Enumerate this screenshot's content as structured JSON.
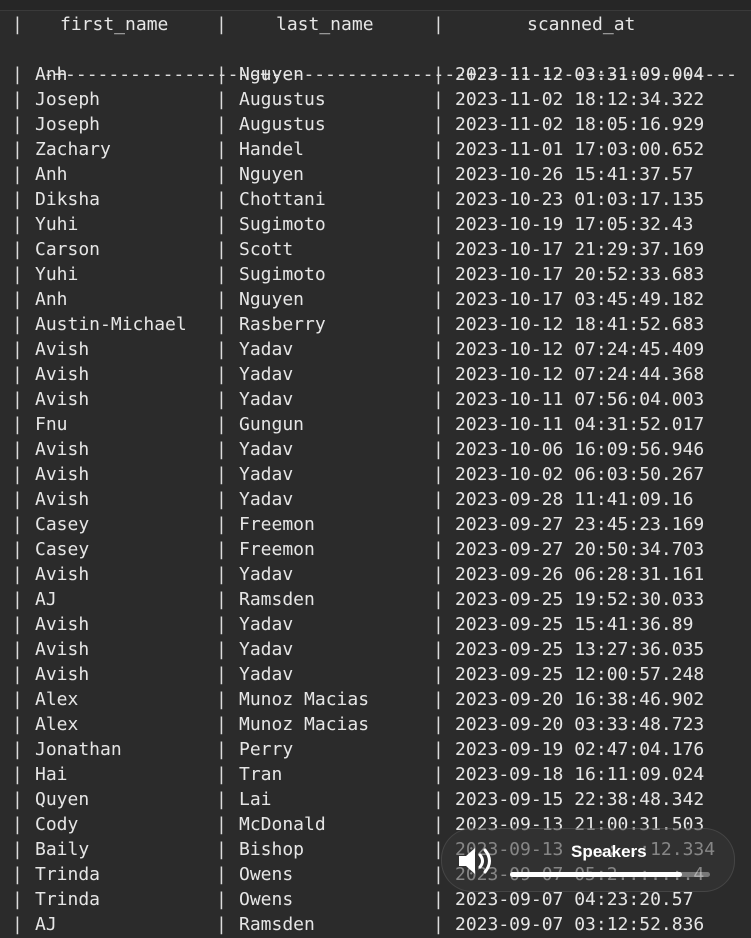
{
  "table": {
    "columns": [
      "first_name",
      "last_name",
      "scanned_at"
    ],
    "separator": "-+------------------+------------------+------------------------",
    "rows": [
      [
        "Anh",
        "Nguyen",
        "2023-11-12 03:31:09.004"
      ],
      [
        "Joseph",
        "Augustus",
        "2023-11-02 18:12:34.322"
      ],
      [
        "Joseph",
        "Augustus",
        "2023-11-02 18:05:16.929"
      ],
      [
        "Zachary",
        "Handel",
        "2023-11-01 17:03:00.652"
      ],
      [
        "Anh",
        "Nguyen",
        "2023-10-26 15:41:37.57"
      ],
      [
        "Diksha",
        "Chottani",
        "2023-10-23 01:03:17.135"
      ],
      [
        "Yuhi",
        "Sugimoto",
        "2023-10-19 17:05:32.43"
      ],
      [
        "Carson",
        "Scott",
        "2023-10-17 21:29:37.169"
      ],
      [
        "Yuhi",
        "Sugimoto",
        "2023-10-17 20:52:33.683"
      ],
      [
        "Anh",
        "Nguyen",
        "2023-10-17 03:45:49.182"
      ],
      [
        "Austin-Michael",
        "Rasberry",
        "2023-10-12 18:41:52.683"
      ],
      [
        "Avish",
        "Yadav",
        "2023-10-12 07:24:45.409"
      ],
      [
        "Avish",
        "Yadav",
        "2023-10-12 07:24:44.368"
      ],
      [
        "Avish",
        "Yadav",
        "2023-10-11 07:56:04.003"
      ],
      [
        "Fnu",
        "Gungun",
        "2023-10-11 04:31:52.017"
      ],
      [
        "Avish",
        "Yadav",
        "2023-10-06 16:09:56.946"
      ],
      [
        "Avish",
        "Yadav",
        "2023-10-02 06:03:50.267"
      ],
      [
        "Avish",
        "Yadav",
        "2023-09-28 11:41:09.16"
      ],
      [
        "Casey",
        "Freemon",
        "2023-09-27 23:45:23.169"
      ],
      [
        "Casey",
        "Freemon",
        "2023-09-27 20:50:34.703"
      ],
      [
        "Avish",
        "Yadav",
        "2023-09-26 06:28:31.161"
      ],
      [
        "AJ",
        "Ramsden",
        "2023-09-25 19:52:30.033"
      ],
      [
        "Avish",
        "Yadav",
        "2023-09-25 15:41:36.89"
      ],
      [
        "Avish",
        "Yadav",
        "2023-09-25 13:27:36.035"
      ],
      [
        "Avish",
        "Yadav",
        "2023-09-25 12:00:57.248"
      ],
      [
        "Alex",
        "Munoz Macias",
        "2023-09-20 16:38:46.902"
      ],
      [
        "Alex",
        "Munoz Macias",
        "2023-09-20 03:33:48.723"
      ],
      [
        "Jonathan",
        "Perry",
        "2023-09-19 02:47:04.176"
      ],
      [
        "Hai",
        "Tran",
        "2023-09-18 16:11:09.024"
      ],
      [
        "Quyen",
        "Lai",
        "2023-09-15 22:38:48.342"
      ],
      [
        "Cody",
        "McDonald",
        "2023-09-13 21:00:31.503"
      ],
      [
        "Baily",
        "Bishop",
        "2023-09-13 ...:..:12.334"
      ],
      [
        "Trinda",
        "Owens",
        "2023-09-07 05:2..:..:.4"
      ],
      [
        "Trinda",
        "Owens",
        "2023-09-07 04:23:20.57"
      ],
      [
        "AJ",
        "Ramsden",
        "2023-09-07 03:12:52.836"
      ]
    ]
  },
  "volume_osd": {
    "label": "Speakers",
    "icon": "speaker-volume-icon",
    "level": 0.86
  }
}
